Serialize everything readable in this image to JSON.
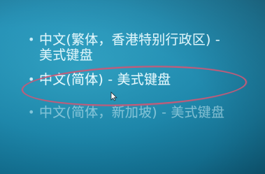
{
  "languages": [
    {
      "label": "中文(繁体，香港特别行政区) - 美式键盘",
      "bullet": "•"
    },
    {
      "label": "中文(简体) - 美式键盘",
      "bullet": "•"
    },
    {
      "label": "中文(简体，新加坡) - 美式键盘",
      "bullet": "•"
    }
  ],
  "colors": {
    "background": "#1c8fb6",
    "text": "#e9fbff",
    "highlight": "#c85a77"
  },
  "icons": {
    "cursor": "mouse-pointer-icon"
  }
}
